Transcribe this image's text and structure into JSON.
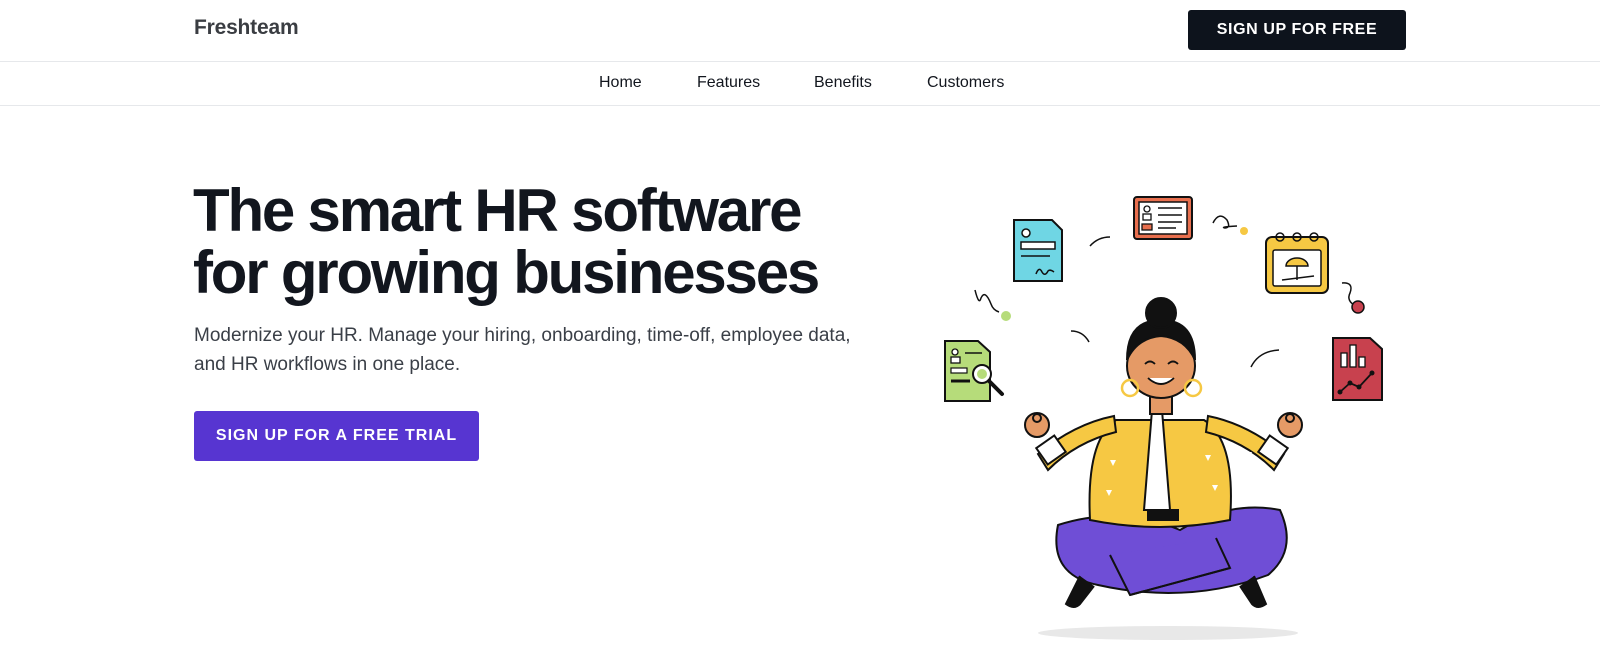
{
  "header": {
    "logo": "Freshteam",
    "signup_label": "SIGN UP FOR FREE"
  },
  "nav": {
    "items": [
      {
        "label": "Home"
      },
      {
        "label": "Features"
      },
      {
        "label": "Benefits"
      },
      {
        "label": "Customers"
      }
    ]
  },
  "hero": {
    "headline": "The smart HR software for growing businesses",
    "subtext": "Modernize your HR. Manage your hiring, onboarding, time-off, employee data, and HR workflows in one place.",
    "cta_label": "SIGN UP FOR A FREE TRIAL"
  },
  "colors": {
    "primary_button": "#5735d1",
    "dark_button": "#0d131c",
    "headline": "#12161e"
  },
  "illustration": {
    "icons": [
      "contract-doc-icon",
      "id-card-icon",
      "vacation-calendar-icon",
      "candidate-search-doc-icon",
      "analytics-report-icon"
    ]
  }
}
